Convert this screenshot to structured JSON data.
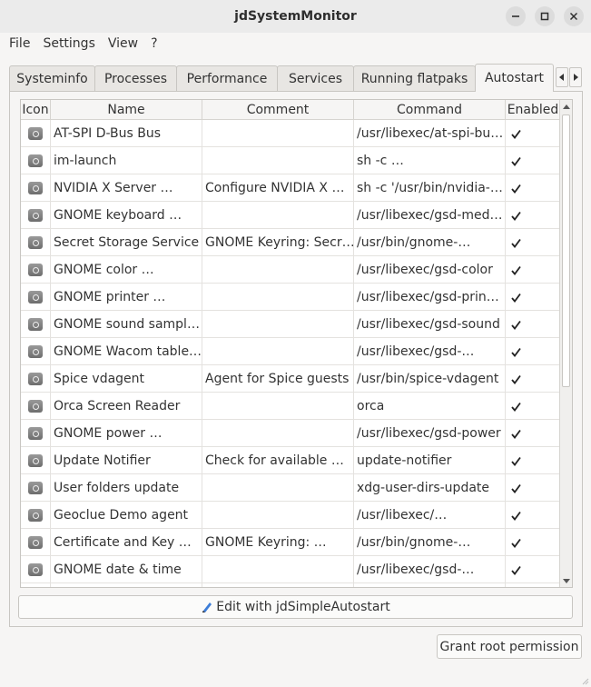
{
  "window": {
    "title": "jdSystemMonitor"
  },
  "menu": [
    "File",
    "Settings",
    "View",
    "?"
  ],
  "tabs": [
    {
      "label": "Systeminfo",
      "active": false
    },
    {
      "label": "Processes",
      "active": false
    },
    {
      "label": "Performance",
      "active": false
    },
    {
      "label": "Services",
      "active": false
    },
    {
      "label": "Running flatpaks",
      "active": false
    },
    {
      "label": "Autostart",
      "active": true
    }
  ],
  "table": {
    "columns": [
      "Icon",
      "Name",
      "Comment",
      "Command",
      "Enabled"
    ],
    "rows": [
      {
        "name": "AT-SPI D-Bus Bus",
        "comment": "",
        "command": "/usr/libexec/at-spi-bu…",
        "enabled": true
      },
      {
        "name": "im-launch",
        "comment": "",
        "command": "sh -c …",
        "enabled": true
      },
      {
        "name": "NVIDIA X Server …",
        "comment": "Configure NVIDIA X …",
        "command": "sh -c '/usr/bin/nvidia-…",
        "enabled": true
      },
      {
        "name": "GNOME keyboard …",
        "comment": "",
        "command": "/usr/libexec/gsd-med…",
        "enabled": true
      },
      {
        "name": "Secret Storage Service",
        "comment": "GNOME Keyring: Secr…",
        "command": "/usr/bin/gnome-…",
        "enabled": true
      },
      {
        "name": "GNOME color …",
        "comment": "",
        "command": "/usr/libexec/gsd-color",
        "enabled": true
      },
      {
        "name": "GNOME printer …",
        "comment": "",
        "command": "/usr/libexec/gsd-prin…",
        "enabled": true
      },
      {
        "name": "GNOME sound sampl…",
        "comment": "",
        "command": "/usr/libexec/gsd-sound",
        "enabled": true
      },
      {
        "name": "GNOME Wacom table…",
        "comment": "",
        "command": "/usr/libexec/gsd-…",
        "enabled": true
      },
      {
        "name": "Spice vdagent",
        "comment": "Agent for Spice guests",
        "command": "/usr/bin/spice-vdagent",
        "enabled": true
      },
      {
        "name": "Orca Screen Reader",
        "comment": "",
        "command": "orca",
        "enabled": true
      },
      {
        "name": "GNOME power …",
        "comment": "",
        "command": "/usr/libexec/gsd-power",
        "enabled": true
      },
      {
        "name": "Update Notifier",
        "comment": "Check for available …",
        "command": "update-notifier",
        "enabled": true
      },
      {
        "name": "User folders update",
        "comment": "",
        "command": "xdg-user-dirs-update",
        "enabled": true
      },
      {
        "name": "Geoclue Demo agent",
        "comment": "",
        "command": "/usr/libexec/…",
        "enabled": true
      },
      {
        "name": "Certificate and Key …",
        "comment": "GNOME Keyring: …",
        "command": "/usr/bin/gnome-…",
        "enabled": true
      },
      {
        "name": "GNOME date & time",
        "comment": "",
        "command": "/usr/libexec/gsd-…",
        "enabled": true
      }
    ]
  },
  "buttons": {
    "edit": "Edit with jdSimpleAutostart",
    "root": "Grant root permission"
  },
  "icons": {
    "row_icon": "app-icon",
    "edit_icon": "pencil-icon"
  }
}
